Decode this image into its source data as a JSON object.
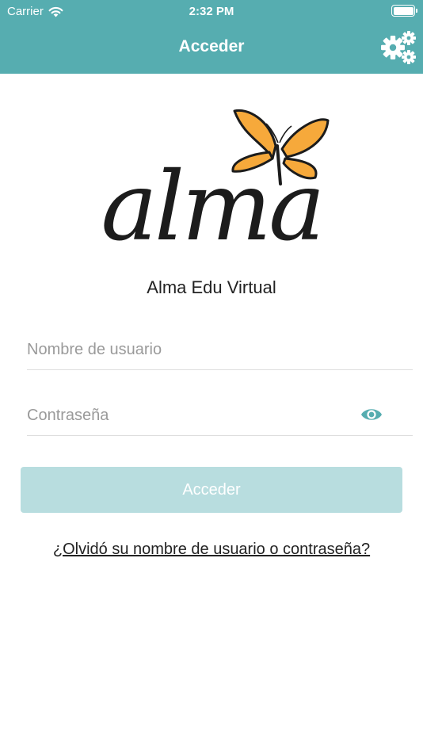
{
  "status_bar": {
    "carrier": "Carrier",
    "time": "2:32 PM"
  },
  "nav": {
    "title": "Acceder"
  },
  "brand": {
    "logo_text": "alma",
    "app_name": "Alma Edu Virtual"
  },
  "form": {
    "username_placeholder": "Nombre de usuario",
    "username_value": "",
    "password_placeholder": "Contraseña",
    "password_value": "",
    "submit_label": "Acceder",
    "forgot_link": "¿Olvidó su nombre de usuario o contraseña?"
  },
  "colors": {
    "accent": "#56adb0",
    "button_disabled": "#b8dddf",
    "butterfly": "#f6a93b",
    "text": "#222222",
    "placeholder": "#9a9a9a"
  },
  "icons": {
    "settings": "gears-icon",
    "show_password": "eye-icon",
    "wifi": "wifi-icon",
    "battery": "battery-icon"
  }
}
